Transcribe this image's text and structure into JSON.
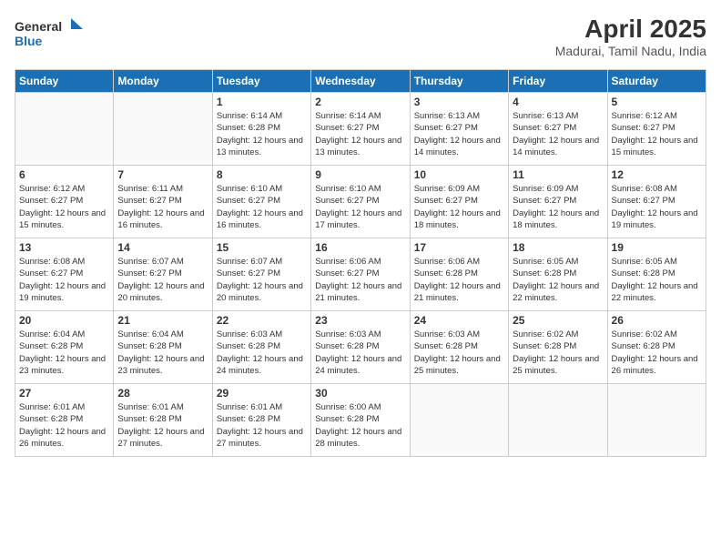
{
  "logo": {
    "text_general": "General",
    "text_blue": "Blue"
  },
  "header": {
    "month": "April 2025",
    "location": "Madurai, Tamil Nadu, India"
  },
  "weekdays": [
    "Sunday",
    "Monday",
    "Tuesday",
    "Wednesday",
    "Thursday",
    "Friday",
    "Saturday"
  ],
  "weeks": [
    [
      {
        "day": "",
        "info": ""
      },
      {
        "day": "",
        "info": ""
      },
      {
        "day": "1",
        "info": "Sunrise: 6:14 AM\nSunset: 6:28 PM\nDaylight: 12 hours and 13 minutes."
      },
      {
        "day": "2",
        "info": "Sunrise: 6:14 AM\nSunset: 6:27 PM\nDaylight: 12 hours and 13 minutes."
      },
      {
        "day": "3",
        "info": "Sunrise: 6:13 AM\nSunset: 6:27 PM\nDaylight: 12 hours and 14 minutes."
      },
      {
        "day": "4",
        "info": "Sunrise: 6:13 AM\nSunset: 6:27 PM\nDaylight: 12 hours and 14 minutes."
      },
      {
        "day": "5",
        "info": "Sunrise: 6:12 AM\nSunset: 6:27 PM\nDaylight: 12 hours and 15 minutes."
      }
    ],
    [
      {
        "day": "6",
        "info": "Sunrise: 6:12 AM\nSunset: 6:27 PM\nDaylight: 12 hours and 15 minutes."
      },
      {
        "day": "7",
        "info": "Sunrise: 6:11 AM\nSunset: 6:27 PM\nDaylight: 12 hours and 16 minutes."
      },
      {
        "day": "8",
        "info": "Sunrise: 6:10 AM\nSunset: 6:27 PM\nDaylight: 12 hours and 16 minutes."
      },
      {
        "day": "9",
        "info": "Sunrise: 6:10 AM\nSunset: 6:27 PM\nDaylight: 12 hours and 17 minutes."
      },
      {
        "day": "10",
        "info": "Sunrise: 6:09 AM\nSunset: 6:27 PM\nDaylight: 12 hours and 18 minutes."
      },
      {
        "day": "11",
        "info": "Sunrise: 6:09 AM\nSunset: 6:27 PM\nDaylight: 12 hours and 18 minutes."
      },
      {
        "day": "12",
        "info": "Sunrise: 6:08 AM\nSunset: 6:27 PM\nDaylight: 12 hours and 19 minutes."
      }
    ],
    [
      {
        "day": "13",
        "info": "Sunrise: 6:08 AM\nSunset: 6:27 PM\nDaylight: 12 hours and 19 minutes."
      },
      {
        "day": "14",
        "info": "Sunrise: 6:07 AM\nSunset: 6:27 PM\nDaylight: 12 hours and 20 minutes."
      },
      {
        "day": "15",
        "info": "Sunrise: 6:07 AM\nSunset: 6:27 PM\nDaylight: 12 hours and 20 minutes."
      },
      {
        "day": "16",
        "info": "Sunrise: 6:06 AM\nSunset: 6:27 PM\nDaylight: 12 hours and 21 minutes."
      },
      {
        "day": "17",
        "info": "Sunrise: 6:06 AM\nSunset: 6:28 PM\nDaylight: 12 hours and 21 minutes."
      },
      {
        "day": "18",
        "info": "Sunrise: 6:05 AM\nSunset: 6:28 PM\nDaylight: 12 hours and 22 minutes."
      },
      {
        "day": "19",
        "info": "Sunrise: 6:05 AM\nSunset: 6:28 PM\nDaylight: 12 hours and 22 minutes."
      }
    ],
    [
      {
        "day": "20",
        "info": "Sunrise: 6:04 AM\nSunset: 6:28 PM\nDaylight: 12 hours and 23 minutes."
      },
      {
        "day": "21",
        "info": "Sunrise: 6:04 AM\nSunset: 6:28 PM\nDaylight: 12 hours and 23 minutes."
      },
      {
        "day": "22",
        "info": "Sunrise: 6:03 AM\nSunset: 6:28 PM\nDaylight: 12 hours and 24 minutes."
      },
      {
        "day": "23",
        "info": "Sunrise: 6:03 AM\nSunset: 6:28 PM\nDaylight: 12 hours and 24 minutes."
      },
      {
        "day": "24",
        "info": "Sunrise: 6:03 AM\nSunset: 6:28 PM\nDaylight: 12 hours and 25 minutes."
      },
      {
        "day": "25",
        "info": "Sunrise: 6:02 AM\nSunset: 6:28 PM\nDaylight: 12 hours and 25 minutes."
      },
      {
        "day": "26",
        "info": "Sunrise: 6:02 AM\nSunset: 6:28 PM\nDaylight: 12 hours and 26 minutes."
      }
    ],
    [
      {
        "day": "27",
        "info": "Sunrise: 6:01 AM\nSunset: 6:28 PM\nDaylight: 12 hours and 26 minutes."
      },
      {
        "day": "28",
        "info": "Sunrise: 6:01 AM\nSunset: 6:28 PM\nDaylight: 12 hours and 27 minutes."
      },
      {
        "day": "29",
        "info": "Sunrise: 6:01 AM\nSunset: 6:28 PM\nDaylight: 12 hours and 27 minutes."
      },
      {
        "day": "30",
        "info": "Sunrise: 6:00 AM\nSunset: 6:28 PM\nDaylight: 12 hours and 28 minutes."
      },
      {
        "day": "",
        "info": ""
      },
      {
        "day": "",
        "info": ""
      },
      {
        "day": "",
        "info": ""
      }
    ]
  ]
}
